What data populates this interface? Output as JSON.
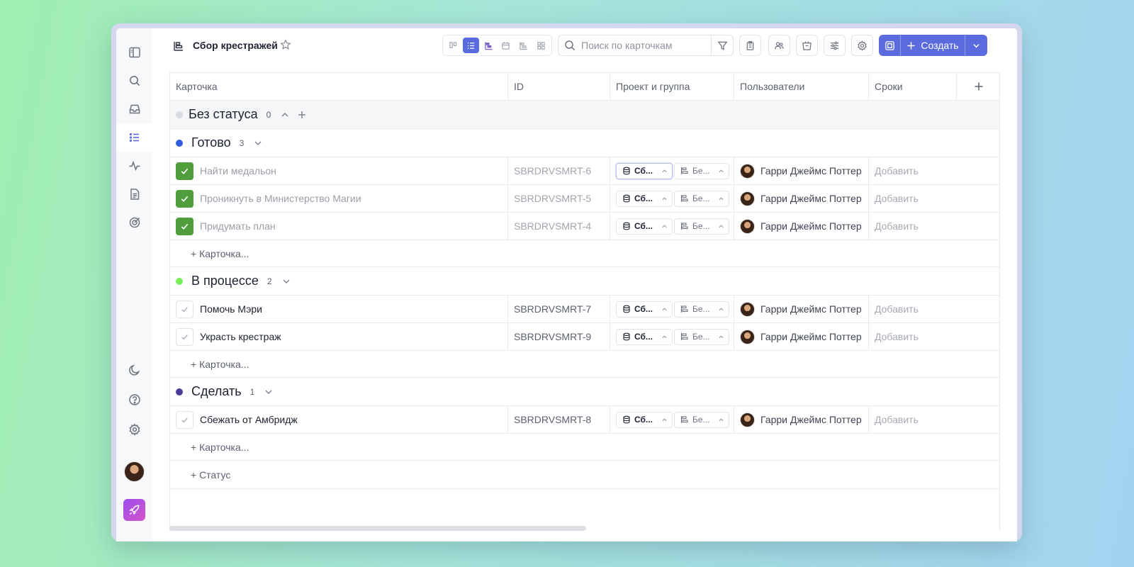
{
  "board": {
    "title": "Сбор крестражей"
  },
  "toolbar": {
    "search_placeholder": "Поиск по карточкам",
    "create_label": "Создать"
  },
  "columns": {
    "card": "Карточка",
    "id": "ID",
    "project": "Проект и группа",
    "users": "Пользователи",
    "dates": "Сроки"
  },
  "add_card_label": "+ Карточка...",
  "add_status_label": "+ Статус",
  "groups": [
    {
      "name": "Без статуса",
      "count": "0",
      "color": "#d8dbe0"
    },
    {
      "name": "Готово",
      "count": "3",
      "color": "#2f5fe0"
    },
    {
      "name": "В процессе",
      "count": "2",
      "color": "#7aee5a"
    },
    {
      "name": "Сделать",
      "count": "1",
      "color": "#4a3d9a"
    }
  ],
  "tasks": [
    {
      "title": "Найти медальон",
      "id": "SBRDRVSMRT-6",
      "project": "Сб...",
      "group": "Бе...",
      "user": "Гарри Джеймс Поттер",
      "date": "Добавить"
    },
    {
      "title": "Проникнуть в Министерство Магии",
      "id": "SBRDRVSMRT-5",
      "project": "Сб...",
      "group": "Бе...",
      "user": "Гарри Джеймс Поттер",
      "date": "Добавить"
    },
    {
      "title": "Придумать план",
      "id": "SBRDRVSMRT-4",
      "project": "Сб...",
      "group": "Бе...",
      "user": "Гарри Джеймс Поттер",
      "date": "Добавить"
    },
    {
      "title": "Помочь Мэри",
      "id": "SBRDRVSMRT-7",
      "project": "Сб...",
      "group": "Бе...",
      "user": "Гарри Джеймс Поттер",
      "date": "Добавить"
    },
    {
      "title": "Украсть крестраж",
      "id": "SBRDRVSMRT-9",
      "project": "Сб...",
      "group": "Бе...",
      "user": "Гарри Джеймс Поттер",
      "date": "Добавить"
    },
    {
      "title": "Сбежать от Амбридж",
      "id": "SBRDRVSMRT-8",
      "project": "Сб...",
      "group": "Бе...",
      "user": "Гарри Джеймс Поттер",
      "date": "Добавить"
    }
  ]
}
